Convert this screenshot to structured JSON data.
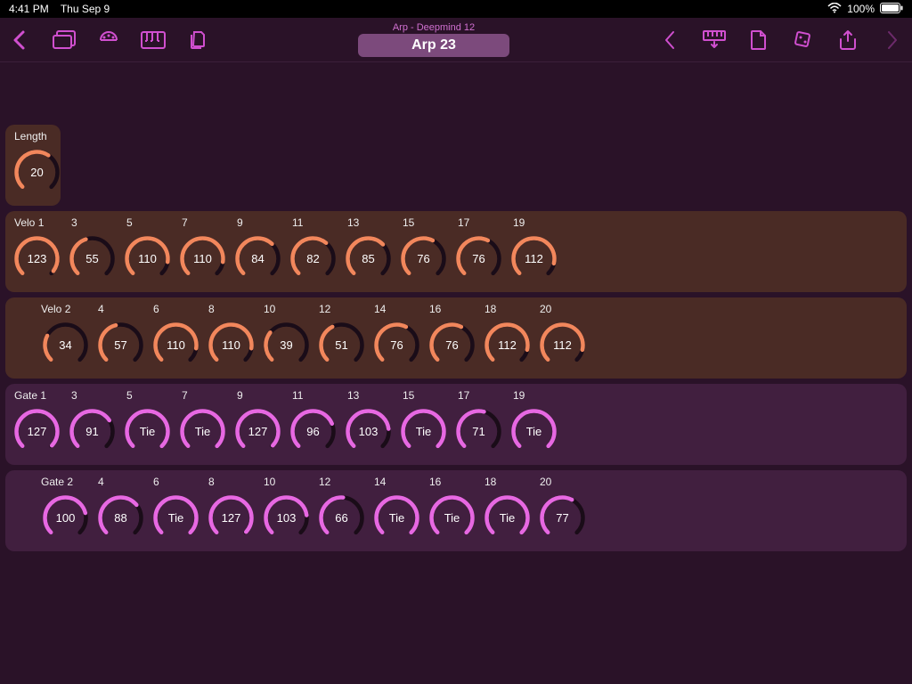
{
  "status": {
    "time": "4:41 PM",
    "day": "Thu Sep 9",
    "battery": "100%"
  },
  "header": {
    "back_icon": "chevron-left",
    "browse_icon": "window-stack",
    "midi_icon": "midi-port",
    "piano_icon": "piano-keys",
    "copy_icon": "documents",
    "subtitle": "Arp - Deepmind 12",
    "title": "Arp 23",
    "prev_icon": "chevron-left",
    "preset_icon": "keyboard-down",
    "file_icon": "file",
    "dice_icon": "dice",
    "share_icon": "share",
    "next_icon": "chevron-right"
  },
  "length": {
    "label": "Length",
    "value": 20,
    "max": 32
  },
  "velo1": {
    "label": "Velo 1",
    "head_numbers": [
      3,
      5,
      7,
      9,
      11,
      13,
      15,
      17,
      19
    ],
    "knobs": [
      {
        "label": "123",
        "val": 123,
        "max": 127
      },
      {
        "label": "55",
        "val": 55,
        "max": 127
      },
      {
        "label": "110",
        "val": 110,
        "max": 127
      },
      {
        "label": "110",
        "val": 110,
        "max": 127
      },
      {
        "label": "84",
        "val": 84,
        "max": 127
      },
      {
        "label": "82",
        "val": 82,
        "max": 127
      },
      {
        "label": "85",
        "val": 85,
        "max": 127
      },
      {
        "label": "76",
        "val": 76,
        "max": 127
      },
      {
        "label": "76",
        "val": 76,
        "max": 127
      },
      {
        "label": "112",
        "val": 112,
        "max": 127
      }
    ]
  },
  "velo2": {
    "label": "Velo 2",
    "head_numbers": [
      4,
      6,
      8,
      10,
      12,
      14,
      16,
      18,
      20
    ],
    "knobs": [
      {
        "label": "34",
        "val": 34,
        "max": 127
      },
      {
        "label": "57",
        "val": 57,
        "max": 127
      },
      {
        "label": "110",
        "val": 110,
        "max": 127
      },
      {
        "label": "110",
        "val": 110,
        "max": 127
      },
      {
        "label": "39",
        "val": 39,
        "max": 127
      },
      {
        "label": "51",
        "val": 51,
        "max": 127
      },
      {
        "label": "76",
        "val": 76,
        "max": 127
      },
      {
        "label": "76",
        "val": 76,
        "max": 127
      },
      {
        "label": "112",
        "val": 112,
        "max": 127
      },
      {
        "label": "112",
        "val": 112,
        "max": 127
      }
    ]
  },
  "gate1": {
    "label": "Gate 1",
    "head_numbers": [
      3,
      5,
      7,
      9,
      11,
      13,
      15,
      17,
      19
    ],
    "knobs": [
      {
        "label": "127",
        "val": 127,
        "max": 128
      },
      {
        "label": "91",
        "val": 91,
        "max": 128
      },
      {
        "label": "Tie",
        "val": 128,
        "max": 128
      },
      {
        "label": "Tie",
        "val": 128,
        "max": 128
      },
      {
        "label": "127",
        "val": 127,
        "max": 128
      },
      {
        "label": "96",
        "val": 96,
        "max": 128
      },
      {
        "label": "103",
        "val": 103,
        "max": 128
      },
      {
        "label": "Tie",
        "val": 128,
        "max": 128
      },
      {
        "label": "71",
        "val": 71,
        "max": 128
      },
      {
        "label": "Tie",
        "val": 128,
        "max": 128
      }
    ]
  },
  "gate2": {
    "label": "Gate 2",
    "head_numbers": [
      4,
      6,
      8,
      10,
      12,
      14,
      16,
      18,
      20
    ],
    "knobs": [
      {
        "label": "100",
        "val": 100,
        "max": 128
      },
      {
        "label": "88",
        "val": 88,
        "max": 128
      },
      {
        "label": "Tie",
        "val": 128,
        "max": 128
      },
      {
        "label": "127",
        "val": 127,
        "max": 128
      },
      {
        "label": "103",
        "val": 103,
        "max": 128
      },
      {
        "label": "66",
        "val": 66,
        "max": 128
      },
      {
        "label": "Tie",
        "val": 128,
        "max": 128
      },
      {
        "label": "Tie",
        "val": 128,
        "max": 128
      },
      {
        "label": "Tie",
        "val": 128,
        "max": 128
      },
      {
        "label": "77",
        "val": 77,
        "max": 128
      }
    ]
  },
  "colors": {
    "velo_accent": "#f2875c",
    "gate_accent": "#e768e2",
    "toolbar_accent": "#d04fcf"
  }
}
